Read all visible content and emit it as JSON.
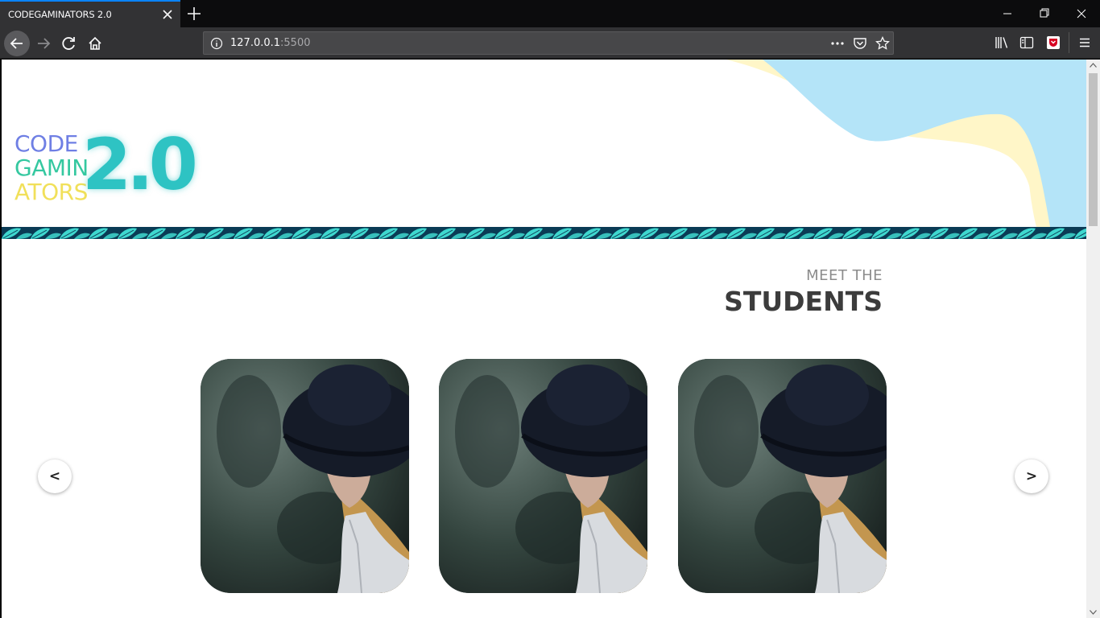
{
  "browser": {
    "tab_title": "CODEGAMINATORS 2.0",
    "url_host": "127.0.0.1",
    "url_port": ":5500"
  },
  "logo": {
    "line1": "CODE",
    "line2": "GAMIN",
    "line3": "ATORS",
    "version": "2.0"
  },
  "section": {
    "kicker": "MEET THE",
    "title": "STUDENTS"
  },
  "carousel": {
    "prev_label": "<",
    "next_label": ">",
    "cards": [
      {
        "image": "student-portrait"
      },
      {
        "image": "student-portrait"
      },
      {
        "image": "student-portrait"
      }
    ]
  },
  "colors": {
    "accent": "#0a84ff",
    "logo_code": "#6f7fe4",
    "logo_gamin": "#35c8a0",
    "logo_ators": "#f1e05a",
    "logo_version": "#2ec3c3",
    "band": "#0b3b55",
    "leaf": "#3fd8cf",
    "wave_blue": "#b4e4f8",
    "wave_yellow": "#fff6c8"
  }
}
